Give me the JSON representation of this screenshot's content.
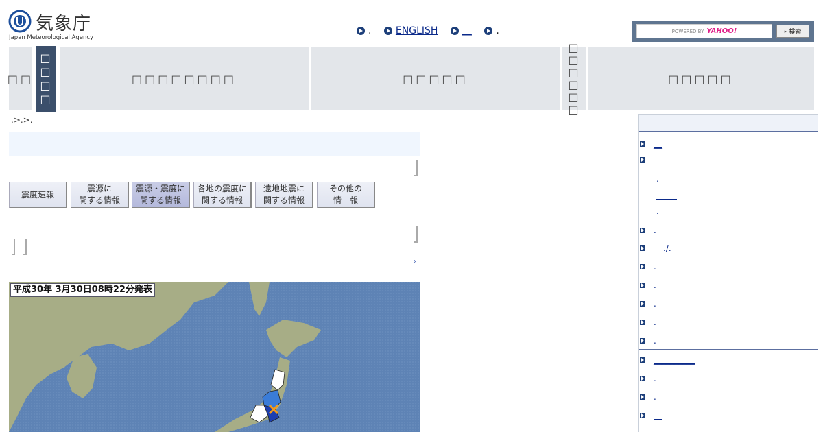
{
  "header": {
    "logo_jp": "気象庁",
    "logo_en": "Japan Meteorological Agency",
    "links": [
      {
        "label": ".",
        "underline": false
      },
      {
        "label": "ENGLISH",
        "underline": true
      },
      {
        "label": "__",
        "underline": true
      },
      {
        "label": ".",
        "underline": false
      }
    ],
    "search": {
      "powered_by": "POWERED BY",
      "brand": "YAHOO!",
      "button": "検索"
    }
  },
  "nav": {
    "items": [
      {
        "label": "□□"
      },
      {
        "label": "□□□□"
      },
      {
        "label": "□□□□□□□□"
      },
      {
        "label": "□□□□□"
      },
      {
        "label": "□□□□□□"
      },
      {
        "label": "□□□□□"
      }
    ]
  },
  "breadcrumb": ".>.>.",
  "tabs": [
    {
      "line1": "震度速報",
      "line2": ""
    },
    {
      "line1": "震源に",
      "line2": "関する情報"
    },
    {
      "line1": "震源・震度に",
      "line2": "関する情報"
    },
    {
      "line1": "各地の震度に",
      "line2": "関する情報"
    },
    {
      "line1": "遠地地震に",
      "line2": "関する情報"
    },
    {
      "line1": "その他の",
      "line2": "情　報"
    }
  ],
  "content": {
    "small_mark": ".",
    "more_arrow": "›"
  },
  "map": {
    "stamp": "平成30年 3月30日08時22分発表",
    "sea_color": "#5e83b5",
    "land_color": "#a7ad86",
    "epicenter_color": "#f39a19"
  },
  "sidebar": {
    "items": [
      {
        "label": "__",
        "underline": true
      },
      {
        "label": "",
        "underline": false
      },
      {
        "label": ".",
        "sub": true
      },
      {
        "label": "_____",
        "sub": true,
        "underline": true
      },
      {
        "label": ".",
        "sub": true
      },
      {
        "label": ".",
        "underline": false
      },
      {
        "label": "./.",
        "underline": false
      },
      {
        "label": ".",
        "underline": false
      },
      {
        "label": ".",
        "underline": false
      },
      {
        "label": ".",
        "underline": false
      },
      {
        "label": ".",
        "underline": false
      },
      {
        "label": ".",
        "underline": false
      },
      {
        "label": "__________",
        "underline": true
      },
      {
        "label": ".",
        "underline": false
      },
      {
        "label": ".",
        "underline": false
      },
      {
        "label": "__",
        "underline": true
      }
    ]
  }
}
